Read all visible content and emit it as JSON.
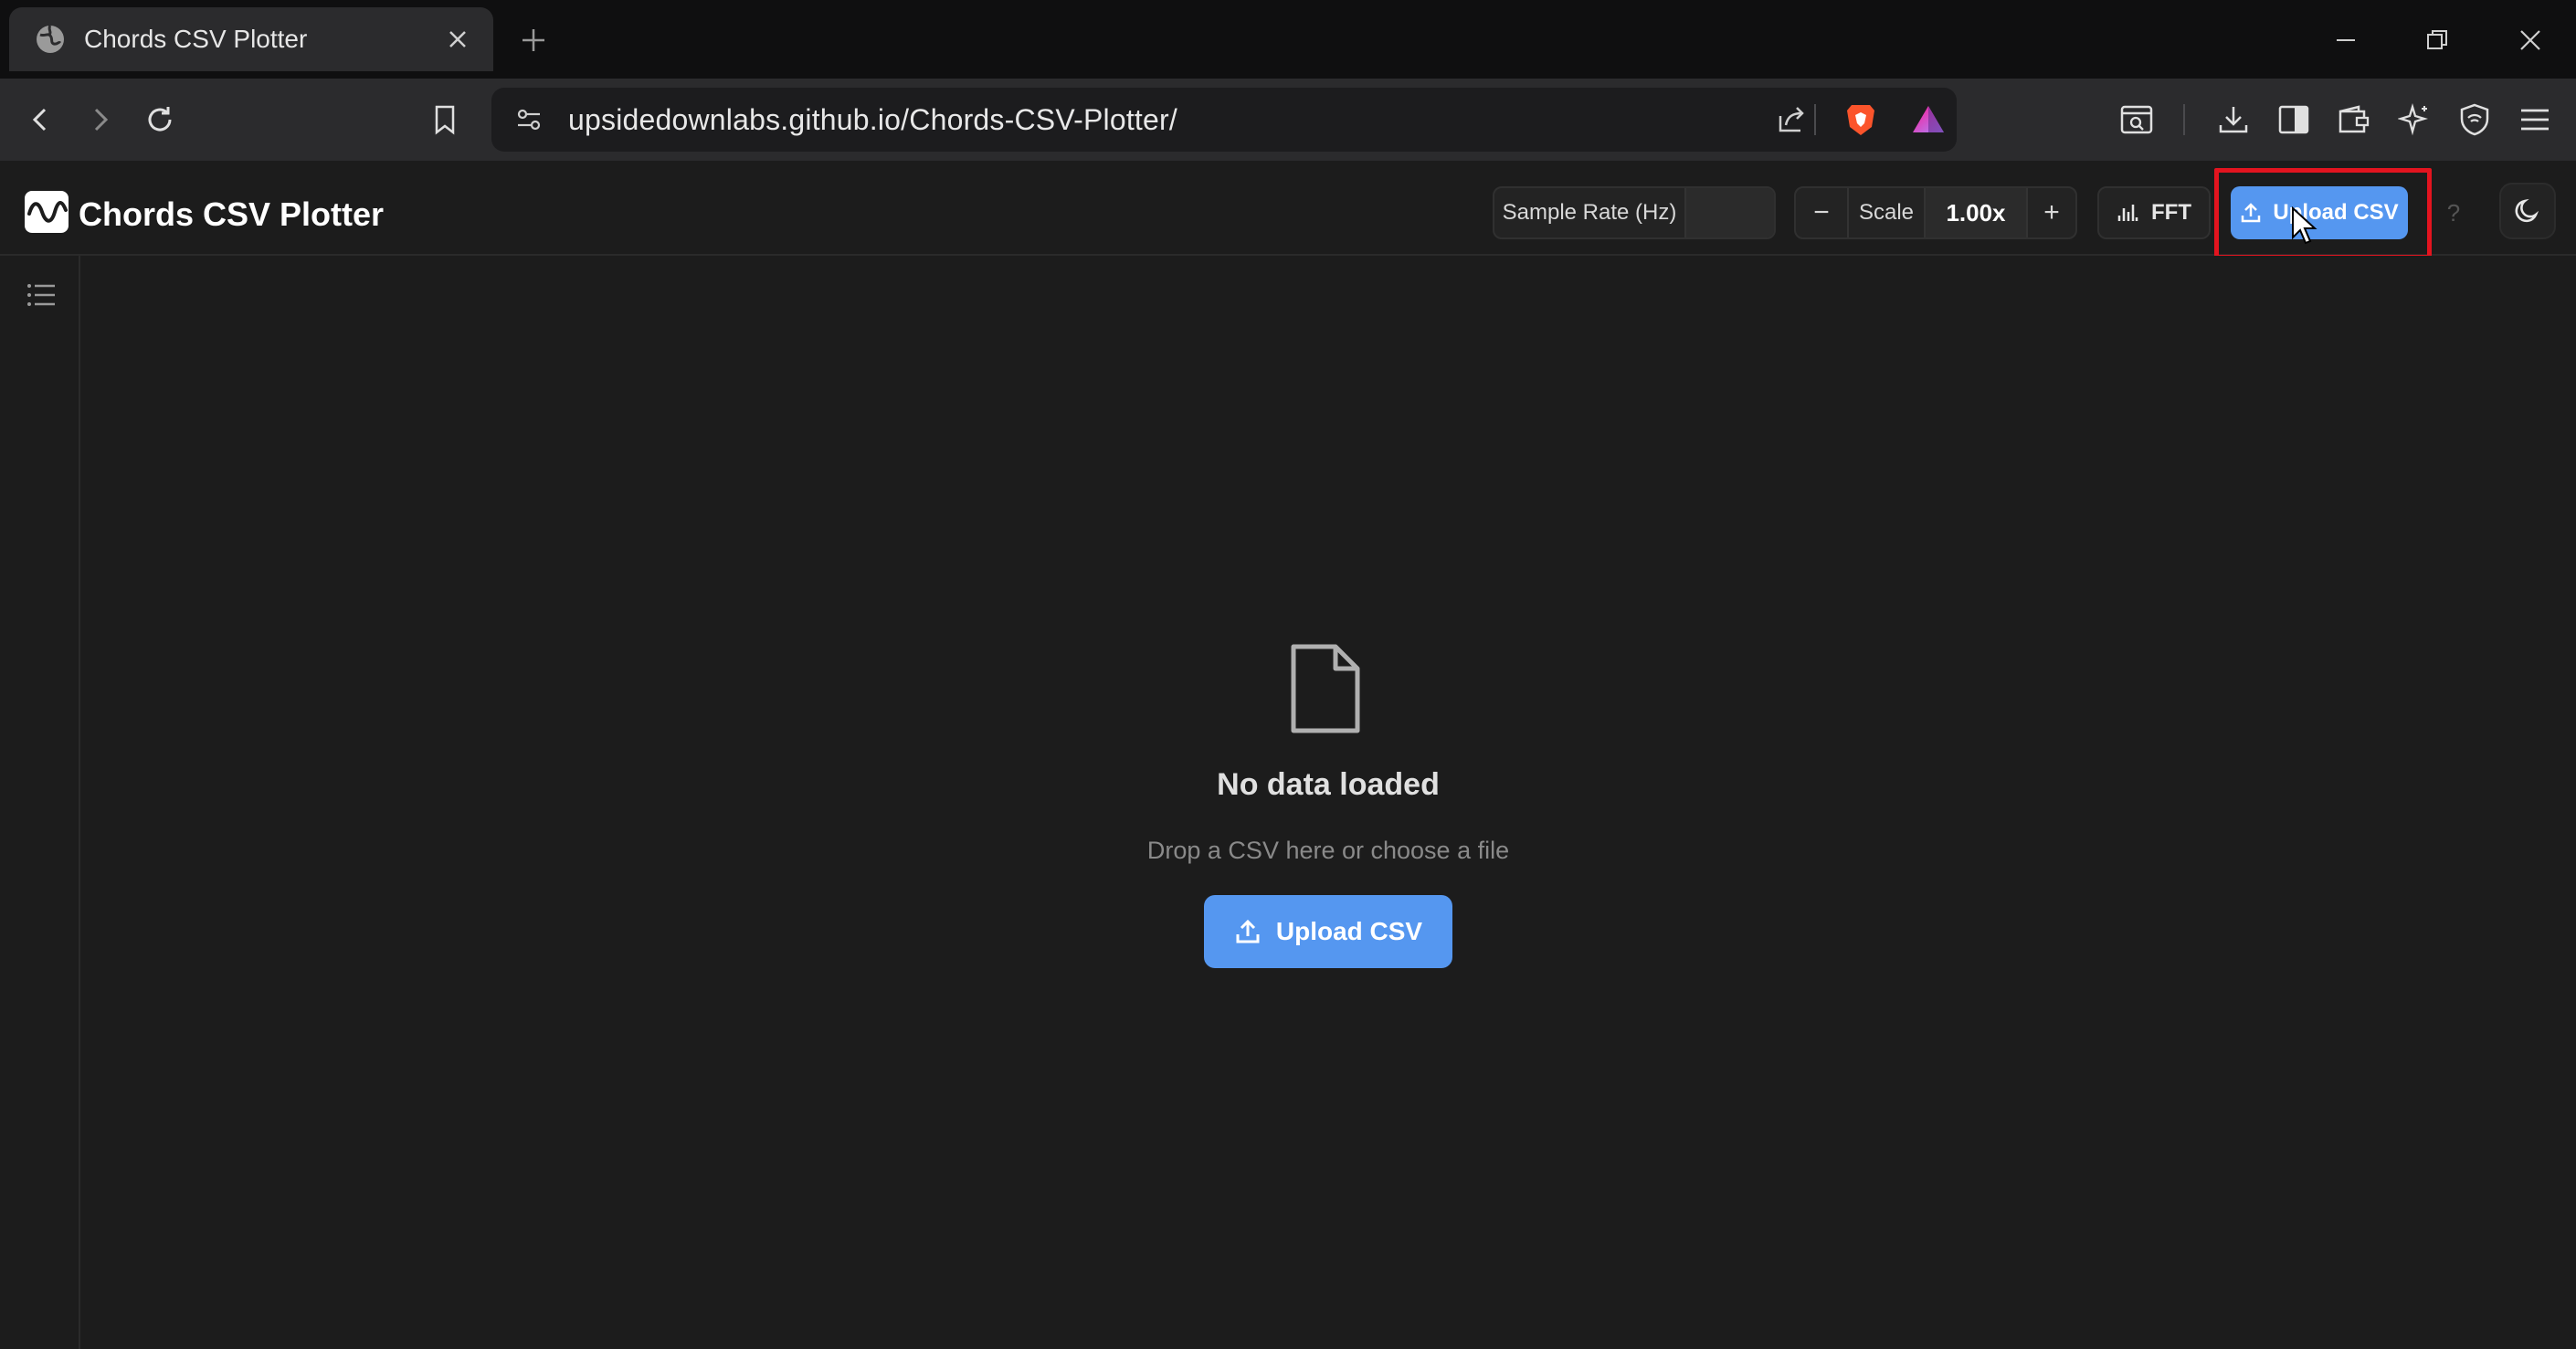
{
  "browser": {
    "tab_title": "Chords CSV Plotter",
    "url": "upsidedownlabs.github.io/Chords-CSV-Plotter/"
  },
  "app": {
    "title": "Chords CSV Plotter",
    "header": {
      "sample_rate_label": "Sample Rate (Hz)",
      "sample_rate_value": "",
      "scale_label": "Scale",
      "scale_value": "1.00x",
      "decrease_label": "−",
      "increase_label": "+",
      "fft_label": "FFT",
      "upload_label": "Upload CSV",
      "help_label": "?"
    },
    "empty_state": {
      "title": "No data loaded",
      "subtitle": "Drop a CSV here or choose a file",
      "upload_label": "Upload CSV"
    }
  },
  "colors": {
    "accent": "#5597f0",
    "highlight": "#e3141f",
    "background": "#1c1c1c"
  }
}
